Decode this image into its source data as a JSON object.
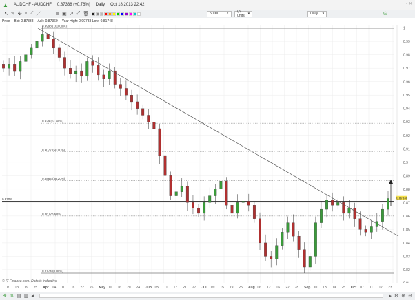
{
  "title": {
    "symbol": "AUDCHF - AUDCHF",
    "price": "0.87338 (+0.76%)",
    "period": "Daily",
    "datetime": "Oct 18 2013 22:42"
  },
  "toolbar": {
    "amount": "50000",
    "units": "(o) units",
    "timeframe": "Daily",
    "swatches": [
      "#222222",
      "#888888",
      "#bbbbbb",
      "#ff0000",
      "#ff9900",
      "#ffff00",
      "#00cc00",
      "#0000ff",
      "#9900cc",
      "#ff00ff",
      "#00cccc",
      "#ffffff"
    ]
  },
  "infobar": {
    "price_label": "Price",
    "bid": "Bid: 0.87338",
    "ask": "Ask: 0.87360",
    "range": "Year High: 0.99783  Low: 0.81748"
  },
  "footer_note": "© IT-Finance.com. Data is indicative",
  "chart_data": {
    "type": "candlestick",
    "ylim": [
      0.8174,
      0.9998
    ],
    "yticks": [
      "1",
      "0.99",
      "0.98",
      "0.97",
      "0.96",
      "0.95",
      "0.94",
      "0.93",
      "0.92",
      "0.91",
      "0.9",
      "0.89",
      "0.88",
      "0.87",
      "0.86",
      "0.85",
      "0.84",
      "0.83",
      "0.82",
      "0.81"
    ],
    "ytick_values": [
      1,
      0.99,
      0.98,
      0.97,
      0.96,
      0.95,
      0.94,
      0.93,
      0.92,
      0.91,
      0.9,
      0.89,
      0.88,
      0.87,
      0.86,
      0.85,
      0.84,
      0.83,
      0.82,
      0.81
    ],
    "xticks": [
      "07",
      "13",
      "19",
      "25",
      "Apr",
      "04",
      "10",
      "16",
      "22",
      "26",
      "May",
      "10",
      "16",
      "20",
      "24",
      "Jun",
      "05",
      "11",
      "17",
      "21",
      "27",
      "Jul",
      "09",
      "15",
      "19",
      "25",
      "Aug",
      "06",
      "12",
      "16",
      "22",
      "28",
      "Sep",
      "10",
      "13",
      "19",
      "25",
      "Oct",
      "07",
      "11",
      "17",
      "23"
    ],
    "closes": [
      0.97,
      0.973,
      0.968,
      0.975,
      0.98,
      0.985,
      0.99,
      0.995,
      0.992,
      0.985,
      0.978,
      0.97,
      0.966,
      0.968,
      0.964,
      0.975,
      0.972,
      0.965,
      0.962,
      0.968,
      0.958,
      0.955,
      0.95,
      0.945,
      0.94,
      0.935,
      0.93,
      0.925,
      0.905,
      0.89,
      0.875,
      0.878,
      0.882,
      0.87,
      0.866,
      0.862,
      0.87,
      0.875,
      0.88,
      0.886,
      0.868,
      0.862,
      0.87,
      0.871,
      0.868,
      0.858,
      0.84,
      0.83,
      0.828,
      0.838,
      0.848,
      0.855,
      0.845,
      0.835,
      0.822,
      0.83,
      0.855,
      0.865,
      0.872,
      0.868,
      0.87,
      0.862,
      0.866,
      0.858,
      0.85,
      0.848,
      0.852,
      0.856,
      0.865,
      0.873
    ],
    "fib_levels": [
      {
        "value": 0.9998,
        "label": "0.9998 (100.00%)"
      },
      {
        "value": 0.929,
        "label": "0.929 (61.80%)"
      },
      {
        "value": 0.9077,
        "label": "0.9077 (50.00%)"
      },
      {
        "value": 0.8864,
        "label": "0.8864 (38.20%)"
      },
      {
        "value": 0.86,
        "label": "0.86 (23.60%)"
      },
      {
        "value": 0.8174,
        "label": "0.8174 (0.00%)"
      }
    ],
    "support_line": {
      "value": 0.8708,
      "label": "0.8708"
    },
    "current_price": {
      "value": 0.87338,
      "label": "0.87338"
    },
    "trendline": {
      "from": 0.9998,
      "to": 0.845
    },
    "colors": {
      "up": "#3a9b3a",
      "down": "#b03030",
      "grid": "#ececec",
      "current": "#f5e04a"
    }
  }
}
